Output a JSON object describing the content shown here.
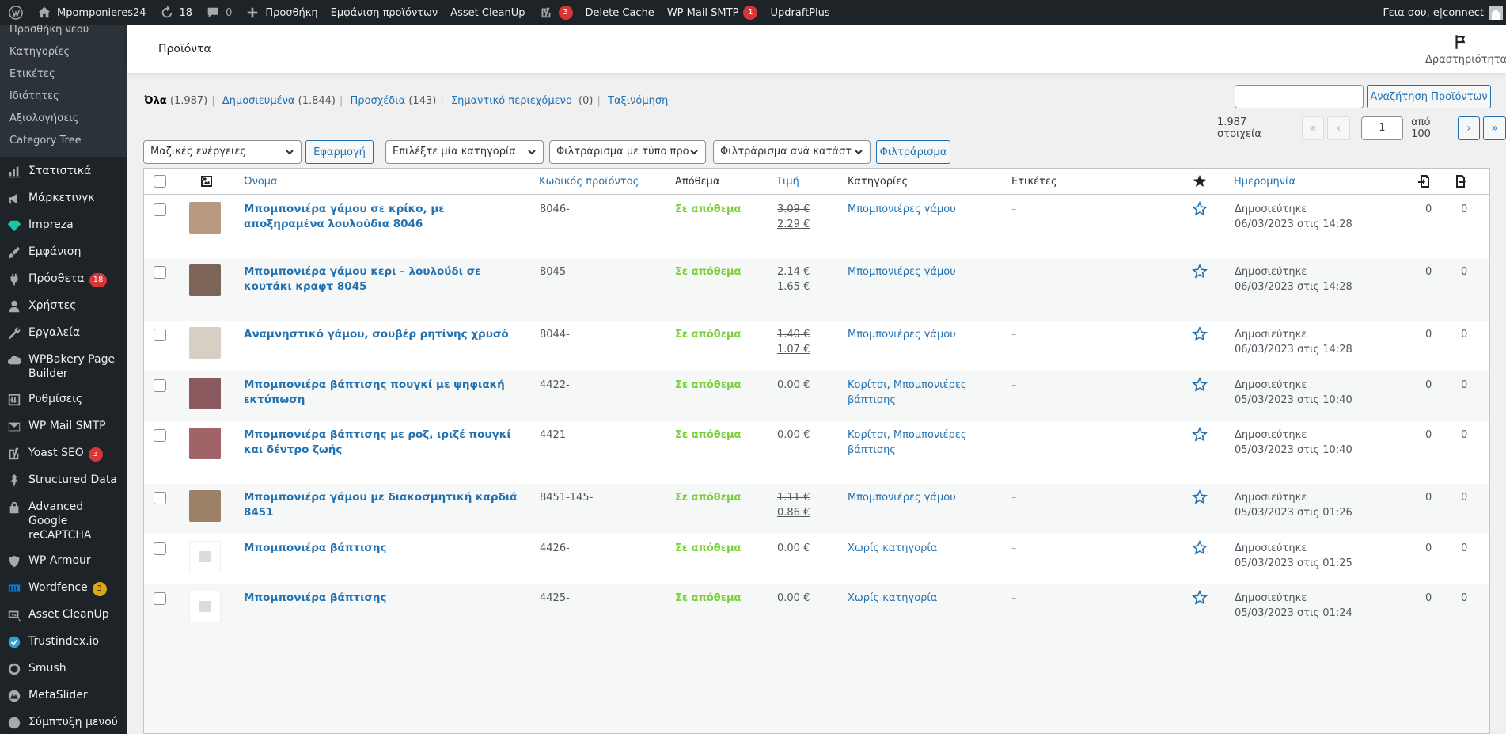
{
  "adminbar": {
    "site_name": "Mpomponieres24",
    "updates_count": "18",
    "comments_count": "0",
    "new_label": "Προσθήκη",
    "view_products": "Εμφάνιση προϊόντων",
    "asset_cleanup": "Asset CleanUp",
    "yoast_badge": "3",
    "delete_cache": "Delete Cache",
    "wp_mail_smtp": "WP Mail SMTP",
    "wp_mail_badge": "1",
    "updraftplus": "UpdraftPlus",
    "greeting": "Γεια σου, e|connect"
  },
  "sidebar": {
    "submenu": [
      "Προσθήκη νέου",
      "Κατηγορίες",
      "Ετικέτες",
      "Ιδιότητες",
      "Αξιολογήσεις",
      "Category Tree"
    ],
    "items": [
      {
        "label": "Στατιστικά",
        "icon": "chart-bar-icon"
      },
      {
        "label": "Μάρκετινγκ",
        "icon": "megaphone-icon"
      },
      {
        "label": "Impreza",
        "icon": "diamond-icon"
      },
      {
        "label": "Εμφάνιση",
        "icon": "paintbrush-icon"
      },
      {
        "label": "Πρόσθετα",
        "icon": "plugin-icon",
        "badge": "18"
      },
      {
        "label": "Χρήστες",
        "icon": "users-icon"
      },
      {
        "label": "Εργαλεία",
        "icon": "wrench-icon"
      },
      {
        "label": "WPBakery Page Builder",
        "icon": "cloud-icon"
      },
      {
        "label": "Ρυθμίσεις",
        "icon": "settings-icon"
      },
      {
        "label": "WP Mail SMTP",
        "icon": "mail-icon"
      },
      {
        "label": "Yoast SEO",
        "icon": "yoast-icon",
        "badge": "3"
      },
      {
        "label": "Structured Data",
        "icon": "pin-icon"
      },
      {
        "label": "Advanced Google reCAPTCHA",
        "icon": "lock-icon"
      },
      {
        "label": "WP Armour",
        "icon": "shield-icon"
      },
      {
        "label": "Wordfence",
        "icon": "wordfence-icon",
        "badge": "3",
        "badge_color": "orange"
      },
      {
        "label": "Asset CleanUp",
        "icon": "asset-cleanup-icon"
      },
      {
        "label": "Trustindex.io",
        "icon": "check-circle-icon"
      },
      {
        "label": "Smush",
        "icon": "smush-icon"
      },
      {
        "label": "MetaSlider",
        "icon": "metaslider-icon"
      },
      {
        "label": "Σύμπτυξη μενού",
        "icon": "collapse-icon"
      }
    ]
  },
  "header": {
    "title": "Προϊόντα",
    "activity": "Δραστηριότητα"
  },
  "views": {
    "all": "Όλα",
    "all_count": "(1.987)",
    "published": "Δημοσιευμένα",
    "published_count": "(1.844)",
    "drafts": "Προσχέδια",
    "drafts_count": "(143)",
    "cornerstone": "Σημαντικό περιεχόμενο",
    "cornerstone_count": "(0)",
    "sorting": "Ταξινόμηση"
  },
  "search": {
    "value": "",
    "button": "Αναζήτηση Προϊόντων"
  },
  "pagination": {
    "items": "1.987 στοιχεία",
    "first": "«",
    "prev": "‹",
    "current": "1",
    "of": "από 100",
    "next": "›",
    "last": "»"
  },
  "filters": {
    "bulk": "Μαζικές ενέργειες",
    "apply": "Εφαρμογή",
    "category": "Επιλέξτε μία κατηγορία",
    "type": "Φιλτράρισμα με τύπο προ",
    "stock": "Φιλτράρισμα ανά κατάστ",
    "filter": "Φιλτράρισμα"
  },
  "table": {
    "columns": {
      "name": "Όνομα",
      "sku": "Κωδικός προϊόντος",
      "stock": "Απόθεμα",
      "price": "Τιμή",
      "categories": "Κατηγορίες",
      "tags": "Ετικέτες",
      "date": "Ημερομηνία"
    },
    "rows": [
      {
        "name": "Μπομπονιέρα γάμου σε κρίκο, με αποξηραμένα λουλούδια 8046",
        "sku": "8046-",
        "stock": "Σε απόθεμα",
        "price_old": "3.09 €",
        "price_new": "2.29 €",
        "categories": "Μπομπονιέρες γάμου",
        "tags": "–",
        "date_status": "Δημοσιεύτηκε",
        "date": "06/03/2023 στις 14:28",
        "c1": "0",
        "c2": "0",
        "thumb_color": "#b89a82"
      },
      {
        "name": "Μπομπονιέρα γάμου κερι – λουλούδι σε κουτάκι κραφτ 8045",
        "sku": "8045-",
        "stock": "Σε απόθεμα",
        "price_old": "2.14 €",
        "price_new": "1.65 €",
        "categories": "Μπομπονιέρες γάμου",
        "tags": "–",
        "date_status": "Δημοσιεύτηκε",
        "date": "06/03/2023 στις 14:28",
        "c1": "0",
        "c2": "0",
        "thumb_color": "#7c6556"
      },
      {
        "name": "Αναμνηστικό γάμου, σουβέρ ρητίνης χρυσό",
        "sku": "8044-",
        "stock": "Σε απόθεμα",
        "price_old": "1.40 €",
        "price_new": "1.07 €",
        "categories": "Μπομπονιέρες γάμου",
        "tags": "–",
        "date_status": "Δημοσιεύτηκε",
        "date": "06/03/2023 στις 14:28",
        "c1": "0",
        "c2": "0",
        "thumb_color": "#d8cfc4"
      },
      {
        "name": "Μπομπονιέρα βάπτισης πουγκί με ψηφιακή εκτύπωση",
        "sku": "4422-",
        "stock": "Σε απόθεμα",
        "price": "0.00 €",
        "categories": "Κορίτσι, Μπομπονιέρες βάπτισης",
        "tags": "–",
        "date_status": "Δημοσιεύτηκε",
        "date": "05/03/2023 στις 10:40",
        "c1": "0",
        "c2": "0",
        "thumb_color": "#8a5a5e"
      },
      {
        "name": "Μπομπονιέρα βάπτισης με ροζ, ιριζέ πουγκί και δέντρο ζωής",
        "sku": "4421-",
        "stock": "Σε απόθεμα",
        "price": "0.00 €",
        "categories": "Κορίτσι, Μπομπονιέρες βάπτισης",
        "tags": "–",
        "date_status": "Δημοσιεύτηκε",
        "date": "05/03/2023 στις 10:40",
        "c1": "0",
        "c2": "0",
        "thumb_color": "#a06468"
      },
      {
        "name": "Μπομπονιέρα γάμου με διακοσμητική καρδιά 8451",
        "sku": "8451-145-",
        "stock": "Σε απόθεμα",
        "price_old": "1.11 €",
        "price_new": "0.86 €",
        "categories": "Μπομπονιέρες γάμου",
        "tags": "–",
        "date_status": "Δημοσιεύτηκε",
        "date": "05/03/2023 στις 01:26",
        "c1": "0",
        "c2": "0",
        "thumb_color": "#9c8068"
      },
      {
        "name": "Μπομπονιέρα βάπτισης",
        "sku": "4426-",
        "stock": "Σε απόθεμα",
        "price": "0.00 €",
        "categories": "Χωρίς κατηγορία",
        "tags": "–",
        "date_status": "Δημοσιεύτηκε",
        "date": "05/03/2023 στις 01:25",
        "c1": "0",
        "c2": "0",
        "thumb_color": ""
      },
      {
        "name": "Μπομπονιέρα βάπτισης",
        "sku": "4425-",
        "stock": "Σε απόθεμα",
        "price": "0.00 €",
        "categories": "Χωρίς κατηγορία",
        "tags": "–",
        "date_status": "Δημοσιεύτηκε",
        "date": "05/03/2023 στις 01:24",
        "c1": "0",
        "c2": "0",
        "thumb_color": ""
      }
    ]
  }
}
